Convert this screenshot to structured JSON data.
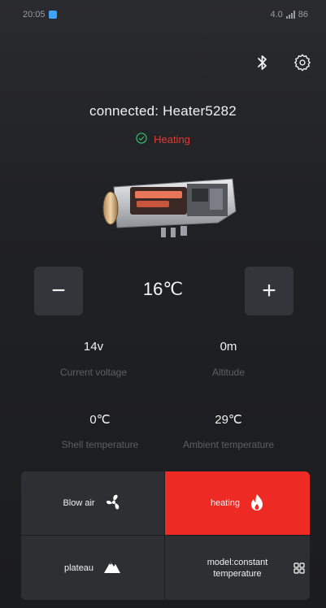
{
  "status_bar": {
    "time": "20:05",
    "right_text": "4.0",
    "battery": "86"
  },
  "header": {
    "connection_text": "connected:  Heater5282",
    "status_text": "Heating"
  },
  "temperature": {
    "minus_label": "−",
    "plus_label": "+",
    "value": "16℃"
  },
  "stats": {
    "voltage_value": "14v",
    "voltage_label": "Current voltage",
    "altitude_value": "0m",
    "altitude_label": "Altitude",
    "shell_value": "0℃",
    "shell_label": "Shell temperature",
    "ambient_value": "29℃",
    "ambient_label": "Ambient temperature"
  },
  "controls": {
    "blow_air_label": "Blow air",
    "heating_label": "heating",
    "plateau_label": "plateau",
    "model_label": "model:constant temperature"
  },
  "colors": {
    "active": "#ee2a24",
    "status_red": "#e23b33",
    "status_green": "#2fb86a",
    "button_bg": "#34353a"
  },
  "icons": {
    "bluetooth": "bluetooth-icon",
    "settings": "gear-icon",
    "status": "check-circle-icon",
    "blow_air": "fan-icon",
    "heating": "flame-icon",
    "plateau": "mountain-icon",
    "model": "grid-icon"
  }
}
